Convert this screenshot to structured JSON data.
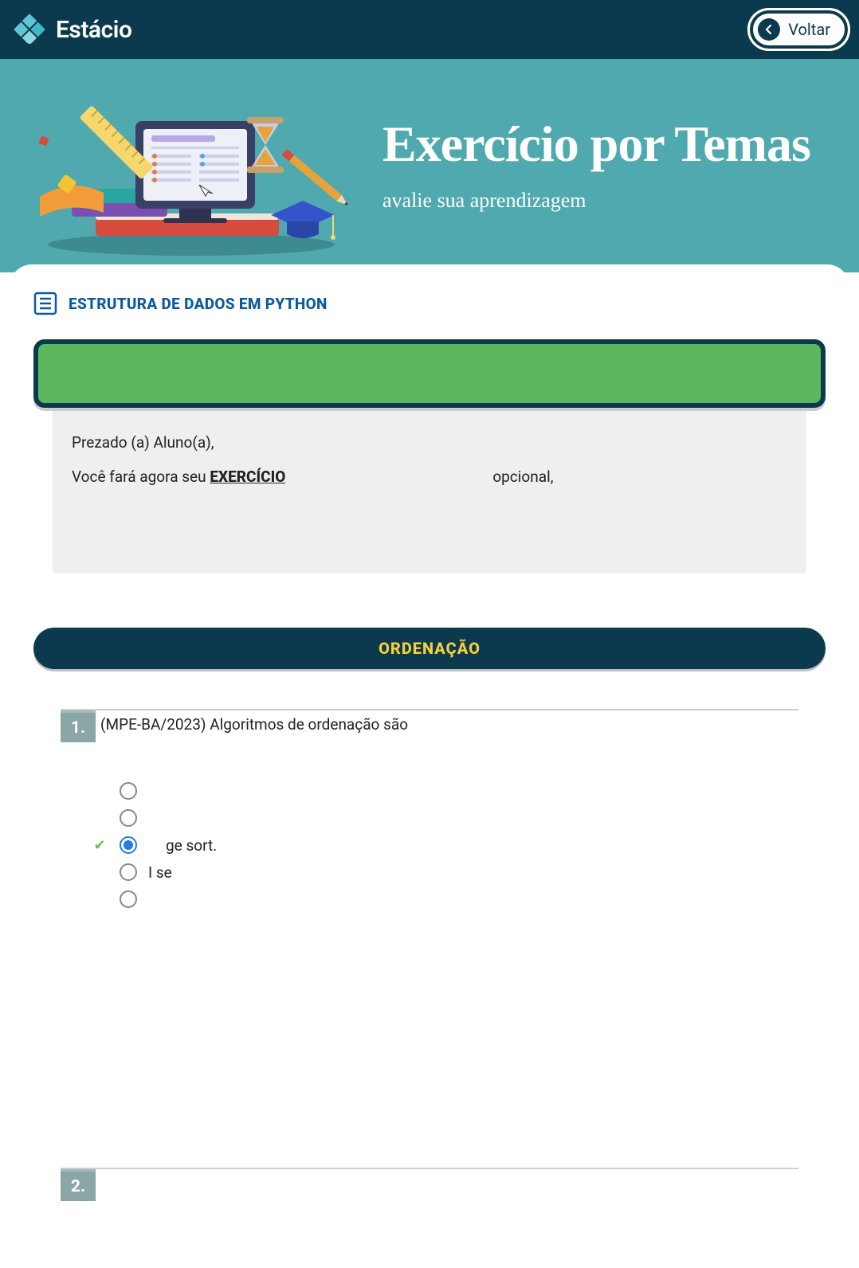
{
  "header": {
    "brand": "Estácio",
    "back_label": "Voltar"
  },
  "hero": {
    "title": "Exercício por Temas",
    "subtitle": "avalie sua aprendizagem"
  },
  "course": {
    "title": "ESTRUTURA DE DADOS EM PYTHON"
  },
  "intro": {
    "greeting": "Prezado (a) Aluno(a),",
    "line2_prefix": "Você fará agora seu ",
    "exercise_word": "EXERCÍCIO",
    "line2_suffix": "opcional,"
  },
  "topic": {
    "label": "ORDENAÇÃO"
  },
  "questions": [
    {
      "number": "1.",
      "text": "(MPE-BA/2023) Algoritmos de ordenação são",
      "options": [
        {
          "label": "",
          "selected": false,
          "correct": false
        },
        {
          "label": "",
          "selected": false,
          "correct": false
        },
        {
          "label": "ge sort.",
          "selected": true,
          "correct": true
        },
        {
          "label": "I   se",
          "selected": false,
          "correct": false
        },
        {
          "label": "",
          "selected": false,
          "correct": false
        }
      ]
    },
    {
      "number": "2.",
      "text": ""
    }
  ]
}
